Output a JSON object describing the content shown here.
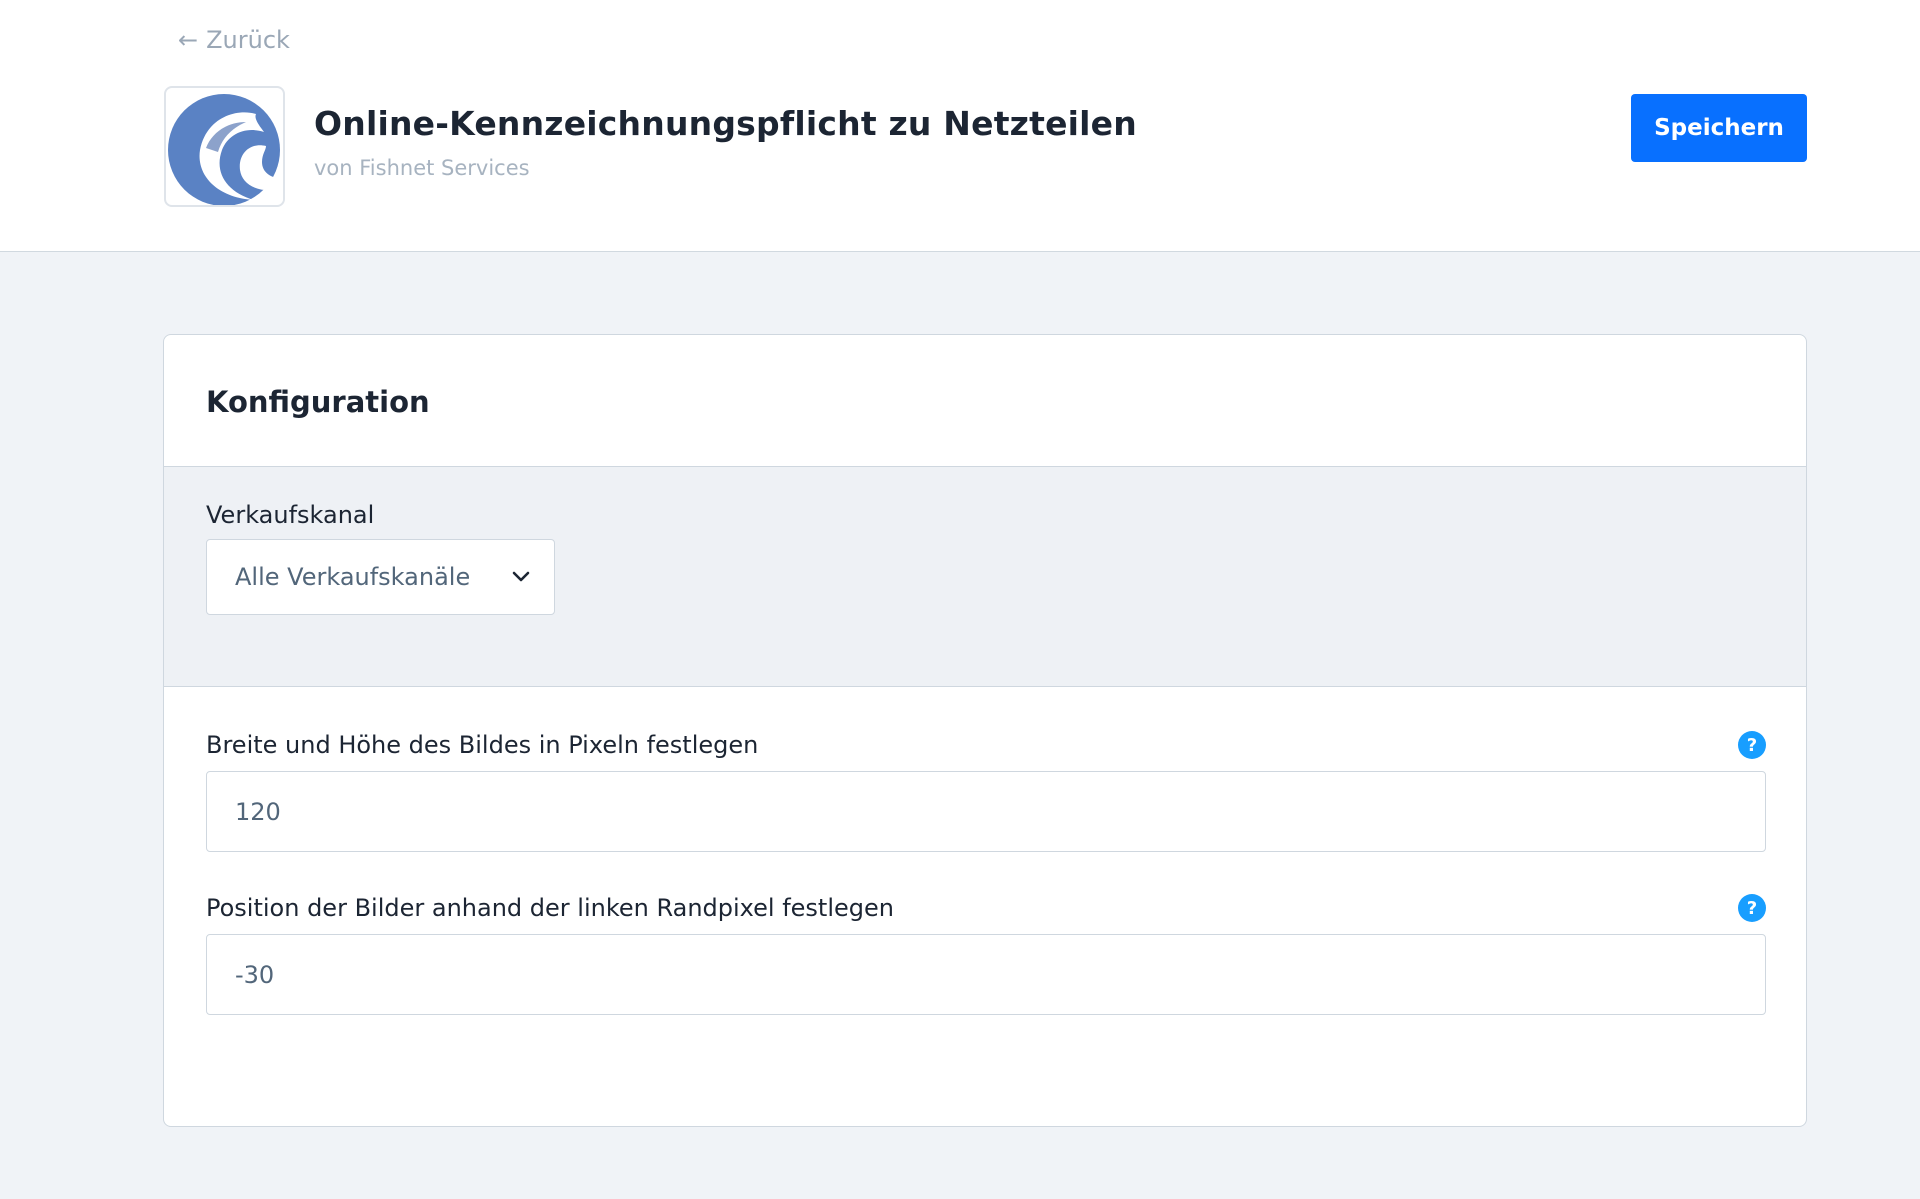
{
  "header": {
    "back_label": "Zurück",
    "app_title": "Online-Kennzeichnungspflicht zu Netzteilen",
    "vendor": "von Fishnet Services",
    "save_label": "Speichern",
    "logo_icon": "wave-logo-icon",
    "accent_color": "#0870ff"
  },
  "card": {
    "title": "Konfiguration",
    "channel": {
      "label": "Verkaufskanal",
      "selected": "Alle Verkaufskanäle"
    },
    "fields": [
      {
        "label": "Breite und Höhe des Bildes in Pixeln festlegen",
        "value": "120",
        "help_icon": "help-icon"
      },
      {
        "label": "Position der Bilder anhand der linken Randpixel festlegen",
        "value": "-30",
        "help_icon": "help-icon"
      }
    ]
  }
}
